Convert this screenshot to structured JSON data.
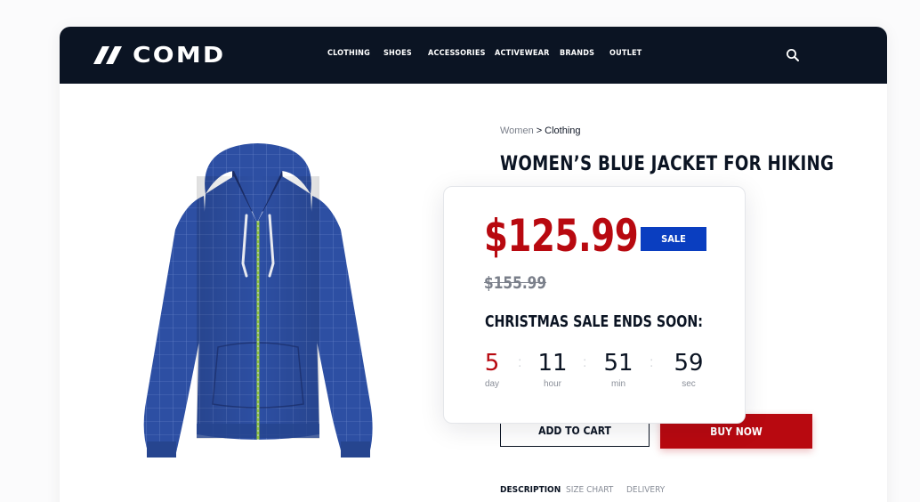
{
  "brand": {
    "name": "COMD"
  },
  "nav": {
    "items": [
      "CLOTHING",
      "SHOES",
      "ACCESSORIES",
      "ACTIVEWEAR",
      "BRANDS",
      "OUTLET"
    ]
  },
  "breadcrumb": {
    "parent": "Women",
    "separator": ">",
    "current": "Clothing"
  },
  "product": {
    "title": "WOMEN’S BLUE JACKET FOR HIKING",
    "price": "$125.99",
    "original_price": "$155.99",
    "badge": "SALE"
  },
  "promo": {
    "heading": "CHRISTMAS SALE ENDS SOON:",
    "countdown": [
      {
        "value": "5",
        "label": "day"
      },
      {
        "value": "11",
        "label": "hour"
      },
      {
        "value": "51",
        "label": "min"
      },
      {
        "value": "59",
        "label": "sec"
      }
    ],
    "separator": ":"
  },
  "actions": {
    "add_to_cart": "ADD TO CART",
    "buy_now": "BUY NOW"
  },
  "tabs": [
    "DESCRIPTION",
    "SIZE CHART",
    "DELIVERY"
  ],
  "colors": {
    "header_bg": "#0b1423",
    "accent_red": "#b80910",
    "badge_blue": "#0a3ec0",
    "jacket_blue": "#2d4fa3"
  },
  "icons": {
    "search": "search-icon",
    "logo": "logo-mark-icon",
    "product_image": "blue-hoodie-jacket"
  }
}
